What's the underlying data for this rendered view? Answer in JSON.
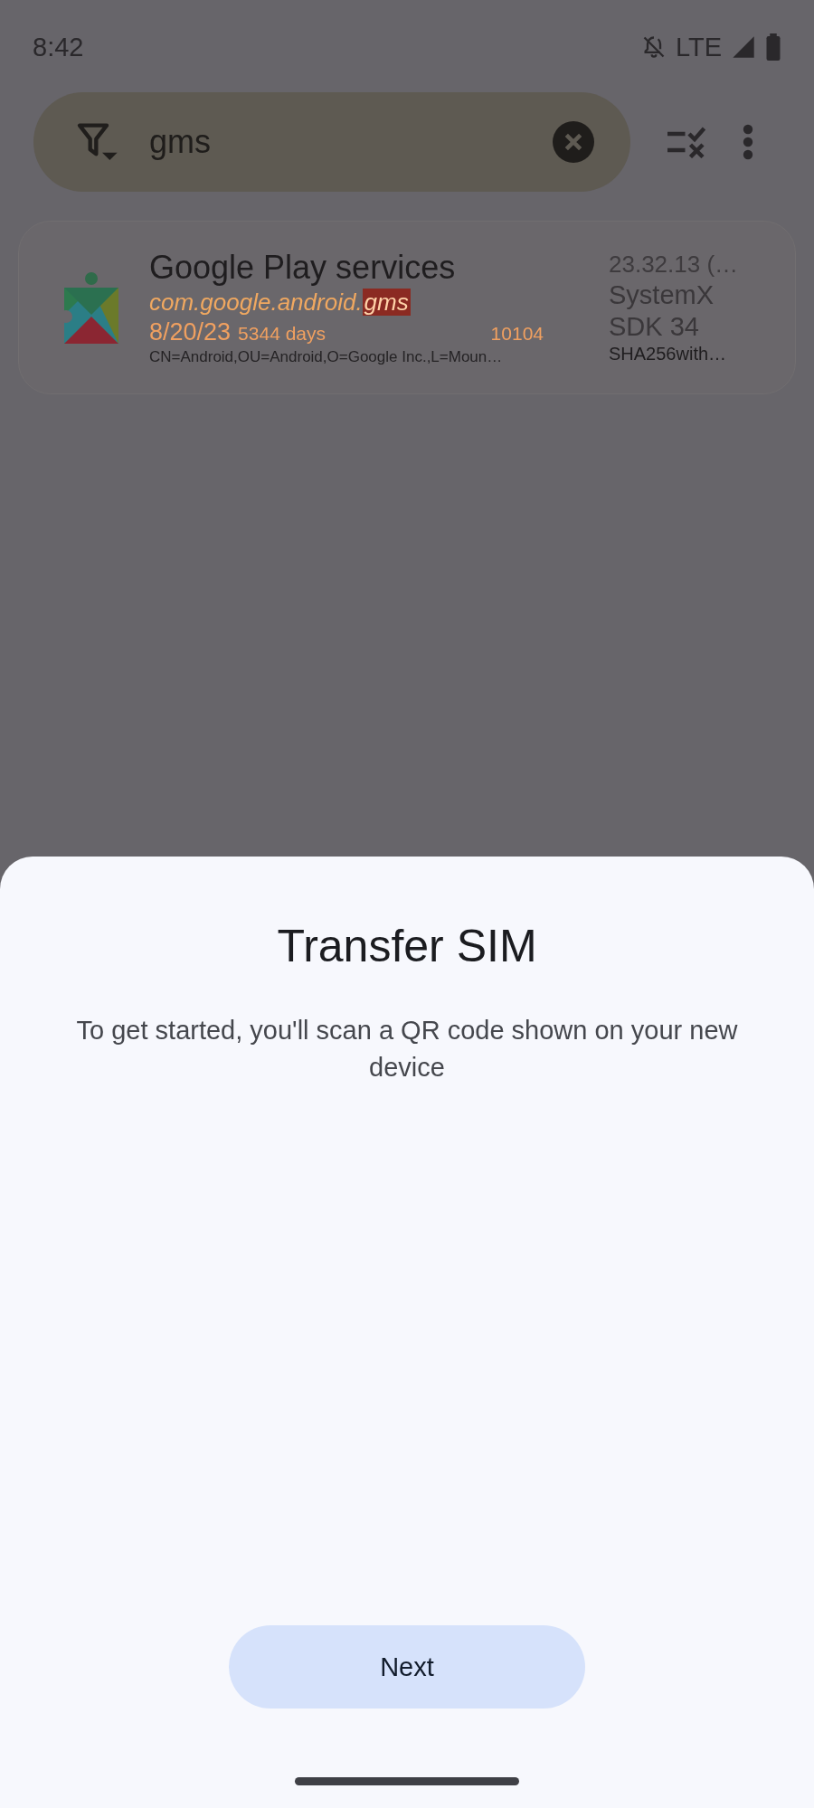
{
  "status_bar": {
    "time": "8:42",
    "network": "LTE"
  },
  "search": {
    "value": "gms"
  },
  "app_card": {
    "name": "Google Play services",
    "package_prefix": "com.google.android.",
    "package_match": "gms",
    "date": "8/20/23",
    "age": "5344 days",
    "uid": "10104",
    "signer": "CN=Android,OU=Android,O=Google Inc.,L=Moun…",
    "version": "23.32.13 (…",
    "install_type": "SystemX",
    "sdk": "SDK 34",
    "signature_algorithm": "SHA256with…"
  },
  "sheet": {
    "title": "Transfer SIM",
    "message": "To get started, you'll scan a QR code shown on your new device",
    "button": "Next"
  }
}
